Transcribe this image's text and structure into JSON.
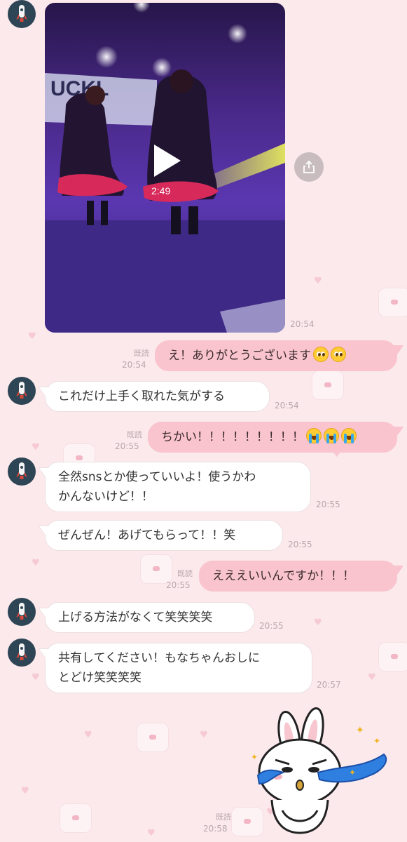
{
  "video": {
    "duration": "2:49",
    "time": "20:54",
    "banner_text": "UCKL"
  },
  "messages": [
    {
      "id": "m1",
      "side": "me",
      "text": "え！ありがとうございます",
      "emojis": [
        "pleading-face-emoji",
        "pleading-face-emoji"
      ],
      "read": "既読",
      "time": "20:54"
    },
    {
      "id": "m2",
      "side": "them",
      "text": "これだけ上手く取れた気がする",
      "time": "20:54"
    },
    {
      "id": "m3",
      "side": "me",
      "text": "ちかい！！！！！！！！！",
      "emojis": [
        "loudly-crying-face-emoji",
        "loudly-crying-face-emoji",
        "loudly-crying-face-emoji"
      ],
      "read": "既読",
      "time": "20:55"
    },
    {
      "id": "m4",
      "side": "them",
      "lines": [
        "全然snsとか使っていいよ！使うかわ",
        "かんないけど！！"
      ],
      "time": "20:55"
    },
    {
      "id": "m5",
      "side": "them",
      "text": "ぜんぜん！あげてもらって！！笑",
      "time": "20:55"
    },
    {
      "id": "m6",
      "side": "me",
      "text": "えええいいんですか！！！",
      "read": "既読",
      "time": "20:55"
    },
    {
      "id": "m7",
      "side": "them",
      "text": "上げる方法がなくて笑笑笑笑",
      "time": "20:55"
    },
    {
      "id": "m8",
      "side": "them",
      "lines": [
        "共有してください！もなちゃんおしに",
        "とどけ笑笑笑笑"
      ],
      "time": "20:57"
    }
  ],
  "sticker": {
    "icon": "crying-rabbit-sticker",
    "read": "既読",
    "time": "20:58"
  },
  "colors": {
    "background": "#fbe9ec",
    "my_bubble": "#f9c4cd",
    "their_bubble": "#ffffff",
    "meta_text": "#b9a7ac"
  }
}
